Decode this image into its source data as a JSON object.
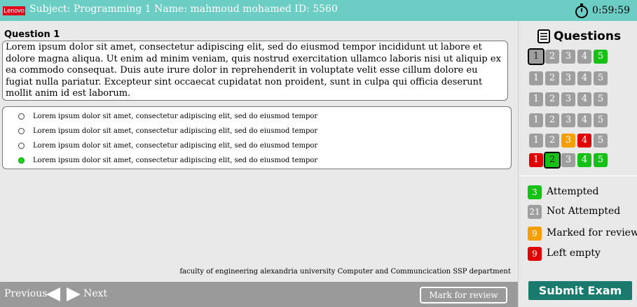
{
  "header": {
    "logo_text": "Lenovo",
    "subject": "Subject: Programming 1  Name: mahmoud mohamed  ID: 5560",
    "timer": "0:59:59"
  },
  "question": {
    "title": "Question 1",
    "text": "Lorem ipsum dolor sit amet, consectetur adipiscing elit, sed do eiusmod tempor incididunt ut labore et dolore magna aliqua. Ut enim ad minim veniam, quis nostrud exercitation ullamco laboris nisi ut aliquip ex ea commodo consequat. Duis aute irure dolor in reprehenderit in voluptate velit esse cillum dolore eu fugiat nulla pariatur. Excepteur sint occaecat cupidatat non proident, sunt in culpa qui officia deserunt mollit anim id est laborum.",
    "options": [
      {
        "label": "Lorem ipsum dolor sit amet, consectetur adipiscing elit, sed do eiusmod tempor",
        "selected": false
      },
      {
        "label": "Lorem ipsum dolor sit amet, consectetur adipiscing elit, sed do eiusmod tempor",
        "selected": false
      },
      {
        "label": "Lorem ipsum dolor sit amet, consectetur adipiscing elit, sed do eiusmod tempor",
        "selected": false
      },
      {
        "label": "Lorem ipsum dolor sit amet, consectetur adipiscing elit, sed do eiusmod tempor",
        "selected": true
      }
    ]
  },
  "footer_note": "faculty of engineering alexandria university Computer and Communcication SSP department",
  "nav": {
    "previous": "Previous",
    "next": "Next",
    "mark_for_review": "Mark for review"
  },
  "sidebar": {
    "title": "Questions",
    "grid": [
      [
        {
          "n": "1",
          "s": "current"
        },
        {
          "n": "2",
          "s": "not"
        },
        {
          "n": "3",
          "s": "not"
        },
        {
          "n": "4",
          "s": "not"
        },
        {
          "n": "5",
          "s": "attempted"
        }
      ],
      [
        {
          "n": "1",
          "s": "not"
        },
        {
          "n": "2",
          "s": "not"
        },
        {
          "n": "3",
          "s": "not"
        },
        {
          "n": "4",
          "s": "not"
        },
        {
          "n": "5",
          "s": "not"
        }
      ],
      [
        {
          "n": "1",
          "s": "not"
        },
        {
          "n": "2",
          "s": "not"
        },
        {
          "n": "3",
          "s": "not"
        },
        {
          "n": "4",
          "s": "not"
        },
        {
          "n": "5",
          "s": "not"
        }
      ],
      [
        {
          "n": "1",
          "s": "not"
        },
        {
          "n": "2",
          "s": "not"
        },
        {
          "n": "3",
          "s": "not"
        },
        {
          "n": "4",
          "s": "not"
        },
        {
          "n": "5",
          "s": "not"
        }
      ],
      [
        {
          "n": "1",
          "s": "not"
        },
        {
          "n": "2",
          "s": "not"
        },
        {
          "n": "3",
          "s": "review"
        },
        {
          "n": "4",
          "s": "empty"
        },
        {
          "n": "5",
          "s": "not"
        }
      ],
      [
        {
          "n": "1",
          "s": "empty"
        },
        {
          "n": "2",
          "s": "current-attempted"
        },
        {
          "n": "3",
          "s": "not"
        },
        {
          "n": "4",
          "s": "attempted"
        },
        {
          "n": "5",
          "s": "attempted"
        }
      ]
    ],
    "legend": [
      {
        "count": "3",
        "label": "Attempted",
        "color": "#16c016"
      },
      {
        "count": "21",
        "label": "Not Attempted",
        "color": "#9e9e9e"
      },
      {
        "count": "9",
        "label": "Marked for review",
        "color": "#f5a000"
      },
      {
        "count": "9",
        "label": "Left empty",
        "color": "#e00000"
      }
    ],
    "submit": "Submit Exam"
  },
  "colors": {
    "header": "#6ccdc5",
    "attempted": "#16c016",
    "not": "#9e9e9e",
    "review": "#f5a000",
    "empty": "#e00000",
    "submit": "#1a7a6e"
  }
}
